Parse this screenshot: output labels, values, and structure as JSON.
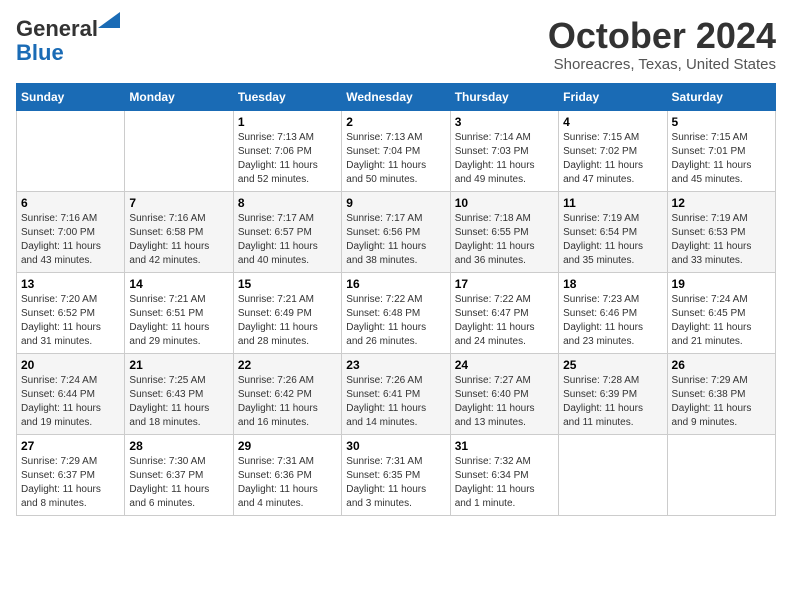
{
  "header": {
    "logo_line1": "General",
    "logo_line2": "Blue",
    "month": "October 2024",
    "location": "Shoreacres, Texas, United States"
  },
  "calendar": {
    "days_of_week": [
      "Sunday",
      "Monday",
      "Tuesday",
      "Wednesday",
      "Thursday",
      "Friday",
      "Saturday"
    ],
    "weeks": [
      [
        {
          "day": "",
          "info": ""
        },
        {
          "day": "",
          "info": ""
        },
        {
          "day": "1",
          "info": "Sunrise: 7:13 AM\nSunset: 7:06 PM\nDaylight: 11 hours\nand 52 minutes."
        },
        {
          "day": "2",
          "info": "Sunrise: 7:13 AM\nSunset: 7:04 PM\nDaylight: 11 hours\nand 50 minutes."
        },
        {
          "day": "3",
          "info": "Sunrise: 7:14 AM\nSunset: 7:03 PM\nDaylight: 11 hours\nand 49 minutes."
        },
        {
          "day": "4",
          "info": "Sunrise: 7:15 AM\nSunset: 7:02 PM\nDaylight: 11 hours\nand 47 minutes."
        },
        {
          "day": "5",
          "info": "Sunrise: 7:15 AM\nSunset: 7:01 PM\nDaylight: 11 hours\nand 45 minutes."
        }
      ],
      [
        {
          "day": "6",
          "info": "Sunrise: 7:16 AM\nSunset: 7:00 PM\nDaylight: 11 hours\nand 43 minutes."
        },
        {
          "day": "7",
          "info": "Sunrise: 7:16 AM\nSunset: 6:58 PM\nDaylight: 11 hours\nand 42 minutes."
        },
        {
          "day": "8",
          "info": "Sunrise: 7:17 AM\nSunset: 6:57 PM\nDaylight: 11 hours\nand 40 minutes."
        },
        {
          "day": "9",
          "info": "Sunrise: 7:17 AM\nSunset: 6:56 PM\nDaylight: 11 hours\nand 38 minutes."
        },
        {
          "day": "10",
          "info": "Sunrise: 7:18 AM\nSunset: 6:55 PM\nDaylight: 11 hours\nand 36 minutes."
        },
        {
          "day": "11",
          "info": "Sunrise: 7:19 AM\nSunset: 6:54 PM\nDaylight: 11 hours\nand 35 minutes."
        },
        {
          "day": "12",
          "info": "Sunrise: 7:19 AM\nSunset: 6:53 PM\nDaylight: 11 hours\nand 33 minutes."
        }
      ],
      [
        {
          "day": "13",
          "info": "Sunrise: 7:20 AM\nSunset: 6:52 PM\nDaylight: 11 hours\nand 31 minutes."
        },
        {
          "day": "14",
          "info": "Sunrise: 7:21 AM\nSunset: 6:51 PM\nDaylight: 11 hours\nand 29 minutes."
        },
        {
          "day": "15",
          "info": "Sunrise: 7:21 AM\nSunset: 6:49 PM\nDaylight: 11 hours\nand 28 minutes."
        },
        {
          "day": "16",
          "info": "Sunrise: 7:22 AM\nSunset: 6:48 PM\nDaylight: 11 hours\nand 26 minutes."
        },
        {
          "day": "17",
          "info": "Sunrise: 7:22 AM\nSunset: 6:47 PM\nDaylight: 11 hours\nand 24 minutes."
        },
        {
          "day": "18",
          "info": "Sunrise: 7:23 AM\nSunset: 6:46 PM\nDaylight: 11 hours\nand 23 minutes."
        },
        {
          "day": "19",
          "info": "Sunrise: 7:24 AM\nSunset: 6:45 PM\nDaylight: 11 hours\nand 21 minutes."
        }
      ],
      [
        {
          "day": "20",
          "info": "Sunrise: 7:24 AM\nSunset: 6:44 PM\nDaylight: 11 hours\nand 19 minutes."
        },
        {
          "day": "21",
          "info": "Sunrise: 7:25 AM\nSunset: 6:43 PM\nDaylight: 11 hours\nand 18 minutes."
        },
        {
          "day": "22",
          "info": "Sunrise: 7:26 AM\nSunset: 6:42 PM\nDaylight: 11 hours\nand 16 minutes."
        },
        {
          "day": "23",
          "info": "Sunrise: 7:26 AM\nSunset: 6:41 PM\nDaylight: 11 hours\nand 14 minutes."
        },
        {
          "day": "24",
          "info": "Sunrise: 7:27 AM\nSunset: 6:40 PM\nDaylight: 11 hours\nand 13 minutes."
        },
        {
          "day": "25",
          "info": "Sunrise: 7:28 AM\nSunset: 6:39 PM\nDaylight: 11 hours\nand 11 minutes."
        },
        {
          "day": "26",
          "info": "Sunrise: 7:29 AM\nSunset: 6:38 PM\nDaylight: 11 hours\nand 9 minutes."
        }
      ],
      [
        {
          "day": "27",
          "info": "Sunrise: 7:29 AM\nSunset: 6:37 PM\nDaylight: 11 hours\nand 8 minutes."
        },
        {
          "day": "28",
          "info": "Sunrise: 7:30 AM\nSunset: 6:37 PM\nDaylight: 11 hours\nand 6 minutes."
        },
        {
          "day": "29",
          "info": "Sunrise: 7:31 AM\nSunset: 6:36 PM\nDaylight: 11 hours\nand 4 minutes."
        },
        {
          "day": "30",
          "info": "Sunrise: 7:31 AM\nSunset: 6:35 PM\nDaylight: 11 hours\nand 3 minutes."
        },
        {
          "day": "31",
          "info": "Sunrise: 7:32 AM\nSunset: 6:34 PM\nDaylight: 11 hours\nand 1 minute."
        },
        {
          "day": "",
          "info": ""
        },
        {
          "day": "",
          "info": ""
        }
      ]
    ]
  }
}
